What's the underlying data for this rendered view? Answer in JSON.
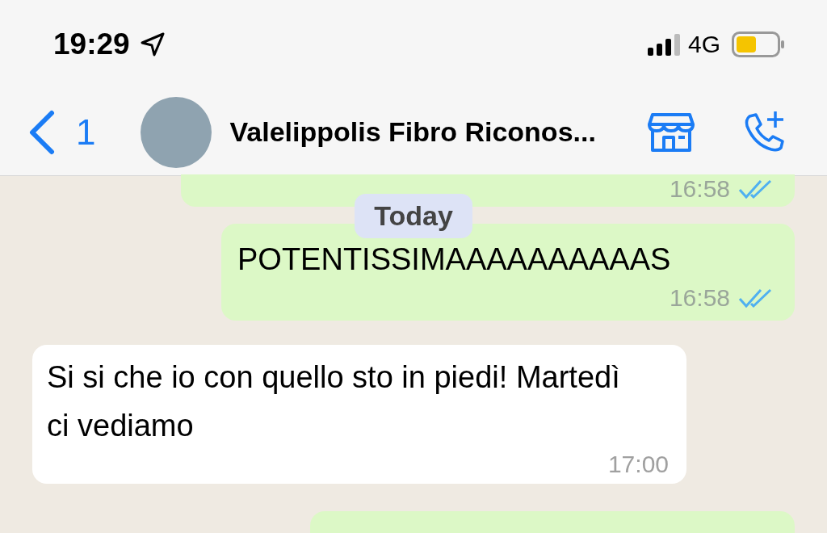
{
  "status_bar": {
    "time": "19:29",
    "network": "4G"
  },
  "header": {
    "back_count": "1",
    "contact_name": "Valelippolis Fibro Riconos..."
  },
  "messages": [
    {
      "kind": "outgoing",
      "time": "16:58",
      "read": true
    },
    {
      "kind": "date",
      "text": "Today"
    },
    {
      "kind": "outgoing",
      "text": "POTENTISSIMAAAAAAAAAAS",
      "time": "16:58",
      "read": true
    },
    {
      "kind": "incoming",
      "text": "Si si che io con quello sto in piedi! Martedì ci vediamo",
      "time": "17:00"
    },
    {
      "kind": "outgoing"
    }
  ]
}
